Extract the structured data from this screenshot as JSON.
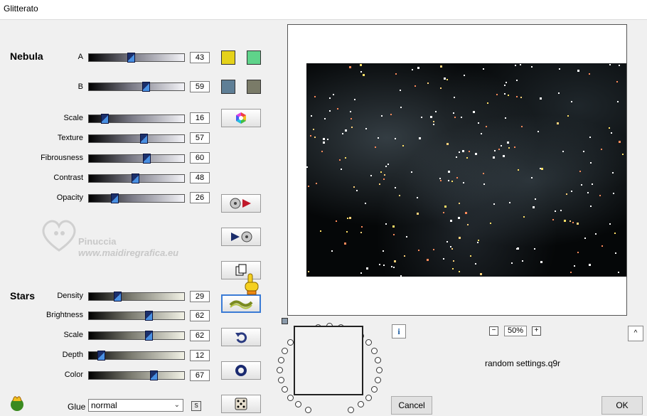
{
  "window": {
    "title": "Glitterato"
  },
  "nebula": {
    "title": "Nebula",
    "sliders": [
      {
        "label": "A",
        "value": 43
      },
      {
        "label": "B",
        "value": 59
      },
      {
        "label": "Scale",
        "value": 16
      },
      {
        "label": "Texture",
        "value": 57
      },
      {
        "label": "Fibrousness",
        "value": 60
      },
      {
        "label": "Contrast",
        "value": 48
      },
      {
        "label": "Opacity",
        "value": 26
      }
    ],
    "colors": {
      "a1": "#e5d21a",
      "a2": "#5fd38a",
      "b1": "#5f7f96",
      "b2": "#7a7b68"
    }
  },
  "stars": {
    "title": "Stars",
    "sliders": [
      {
        "label": "Density",
        "value": 29
      },
      {
        "label": "Brightness",
        "value": 62
      },
      {
        "label": "Scale",
        "value": 62
      },
      {
        "label": "Depth",
        "value": 12
      },
      {
        "label": "Color",
        "value": 67
      }
    ]
  },
  "glue": {
    "label": "Glue",
    "value": "normal",
    "s_label": "S"
  },
  "watermark": {
    "line1": "Pinuccia",
    "line2": "www.maidiregrafica.eu"
  },
  "zoom": {
    "value": "50%",
    "minus": "−",
    "plus": "+"
  },
  "preset": {
    "name": "random settings.q9r"
  },
  "buttons": {
    "cancel": "Cancel",
    "ok": "OK",
    "info": "i",
    "up": "^"
  }
}
